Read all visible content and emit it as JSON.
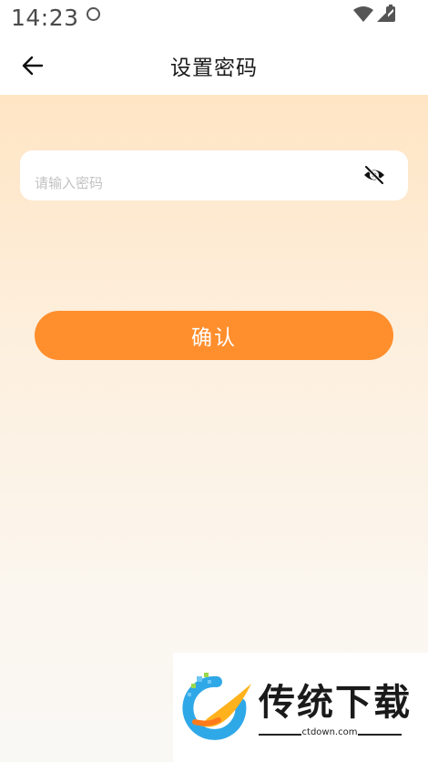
{
  "status_bar": {
    "time": "14:23"
  },
  "header": {
    "title": "设置密码",
    "back_icon": "arrow-left-icon"
  },
  "form": {
    "password_placeholder": "请输入密码",
    "password_value": "",
    "visibility_icon": "eye-off-icon",
    "confirm_label": "确认"
  },
  "colors": {
    "accent": "#ff8e2d",
    "gradient_top": "#ffe5c4",
    "gradient_bottom": "#faf8f5"
  },
  "watermark": {
    "title": "传统下载",
    "url": "ctdown.com"
  }
}
